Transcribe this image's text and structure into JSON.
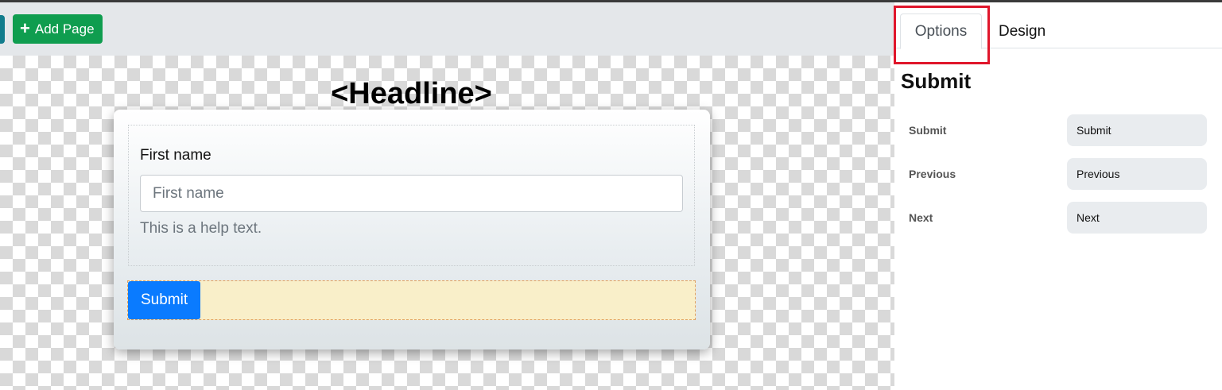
{
  "toolbar": {
    "add_page_label": "Add Page"
  },
  "canvas": {
    "headline": "<Headline>",
    "field": {
      "label": "First name",
      "placeholder": "First name",
      "help_text": "This is a help text."
    },
    "submit_label": "Submit"
  },
  "panel": {
    "tabs": [
      {
        "label": "Options",
        "active": true
      },
      {
        "label": "Design",
        "active": false
      }
    ],
    "title": "Submit",
    "options": [
      {
        "label": "Submit",
        "value": "Submit"
      },
      {
        "label": "Previous",
        "value": "Previous"
      },
      {
        "label": "Next",
        "value": "Next"
      }
    ]
  },
  "colors": {
    "add_page_button": "#0f9d4f",
    "submit_button": "#0a7bff",
    "tab_highlight": "#e0162b",
    "submit_zone": "#f9efc9"
  }
}
